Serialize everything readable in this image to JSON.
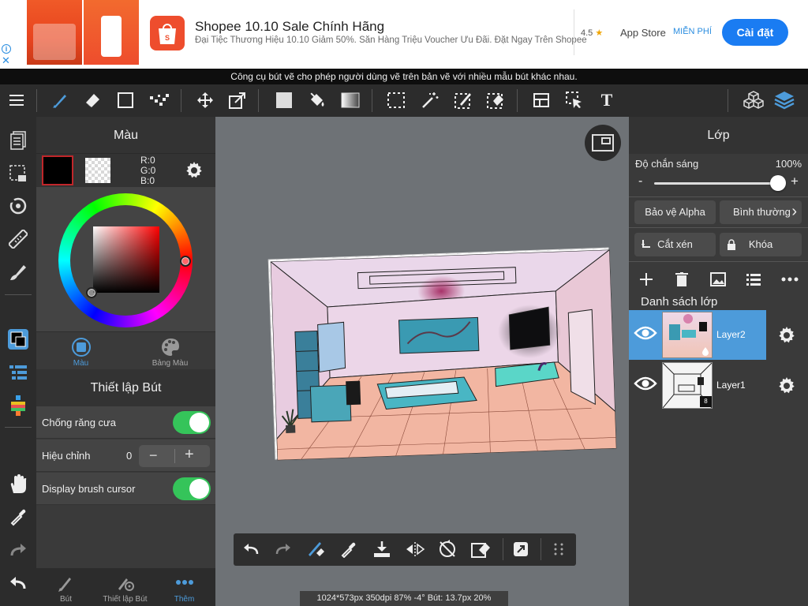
{
  "ad": {
    "title": "Shopee 10.10 Sale Chính Hãng",
    "subtitle": "Đại Tiệc Thương Hiệu 10.10 Giảm 50%. Săn Hàng Triệu Voucher Ưu Đãi. Đặt Ngay Trên Shopee",
    "rating": "4.5",
    "rating_star": "★",
    "store": "App Store",
    "price": "MIỄN PHÍ",
    "install": "Cài đặt",
    "info_icon": "i",
    "close_icon": "✕",
    "brand_color": "#ee4d2d",
    "button_color": "#1a7cf2"
  },
  "hint": "Công cụ bút vẽ cho phép người dùng vẽ trên bản vẽ với nhiều mẫu bút khác nhau.",
  "toolbar": {
    "tools": [
      "menu-icon",
      "brush-icon",
      "eraser-icon",
      "rectangle-icon",
      "dot-brush-icon",
      "move-icon",
      "transform-icon",
      "fill-color-icon",
      "bucket-icon",
      "gradient-icon",
      "select-icon",
      "magic-wand-icon",
      "select-pen-icon",
      "select-eraser-icon",
      "layout-icon",
      "cursor-icon",
      "text-icon",
      "3d-icon",
      "layers-icon"
    ],
    "text_tool_glyph": "T"
  },
  "color_panel": {
    "title": "Màu",
    "rgb_r": "R:0",
    "rgb_g": "G:0",
    "rgb_b": "B:0",
    "tab_color": "Màu",
    "tab_palette": "Bảng Màu"
  },
  "brush_settings": {
    "title": "Thiết lập Bút",
    "antialias_label": "Chống răng cưa",
    "correction_label": "Hiệu chỉnh",
    "correction_value": "0",
    "minus": "−",
    "plus": "+",
    "cursor_label": "Display brush cursor"
  },
  "bottom_tabs": {
    "brush": "Bút",
    "settings": "Thiết lập Bút",
    "more": "Thêm"
  },
  "status": "1024*573px 350dpi 87% -4° Bút: 13.7px 20%",
  "layers": {
    "title": "Lớp",
    "opacity_label": "Độ chắn sáng",
    "opacity_value": "100%",
    "opacity_minus": "-",
    "opacity_plus": "+",
    "protect_alpha": "Bảo vệ Alpha",
    "blend_mode": "Bình thường",
    "blend_chevron": "›",
    "clipping": "Cắt xén",
    "lock": "Khóa",
    "list_title": "Danh sách lớp",
    "items": [
      {
        "name": "Layer2",
        "selected": true
      },
      {
        "name": "Layer1",
        "selected": false,
        "badge": "8"
      }
    ]
  },
  "colors": {
    "accent": "#4d9bda",
    "toggle_on": "#35c45a",
    "selected_color": "#000000"
  }
}
